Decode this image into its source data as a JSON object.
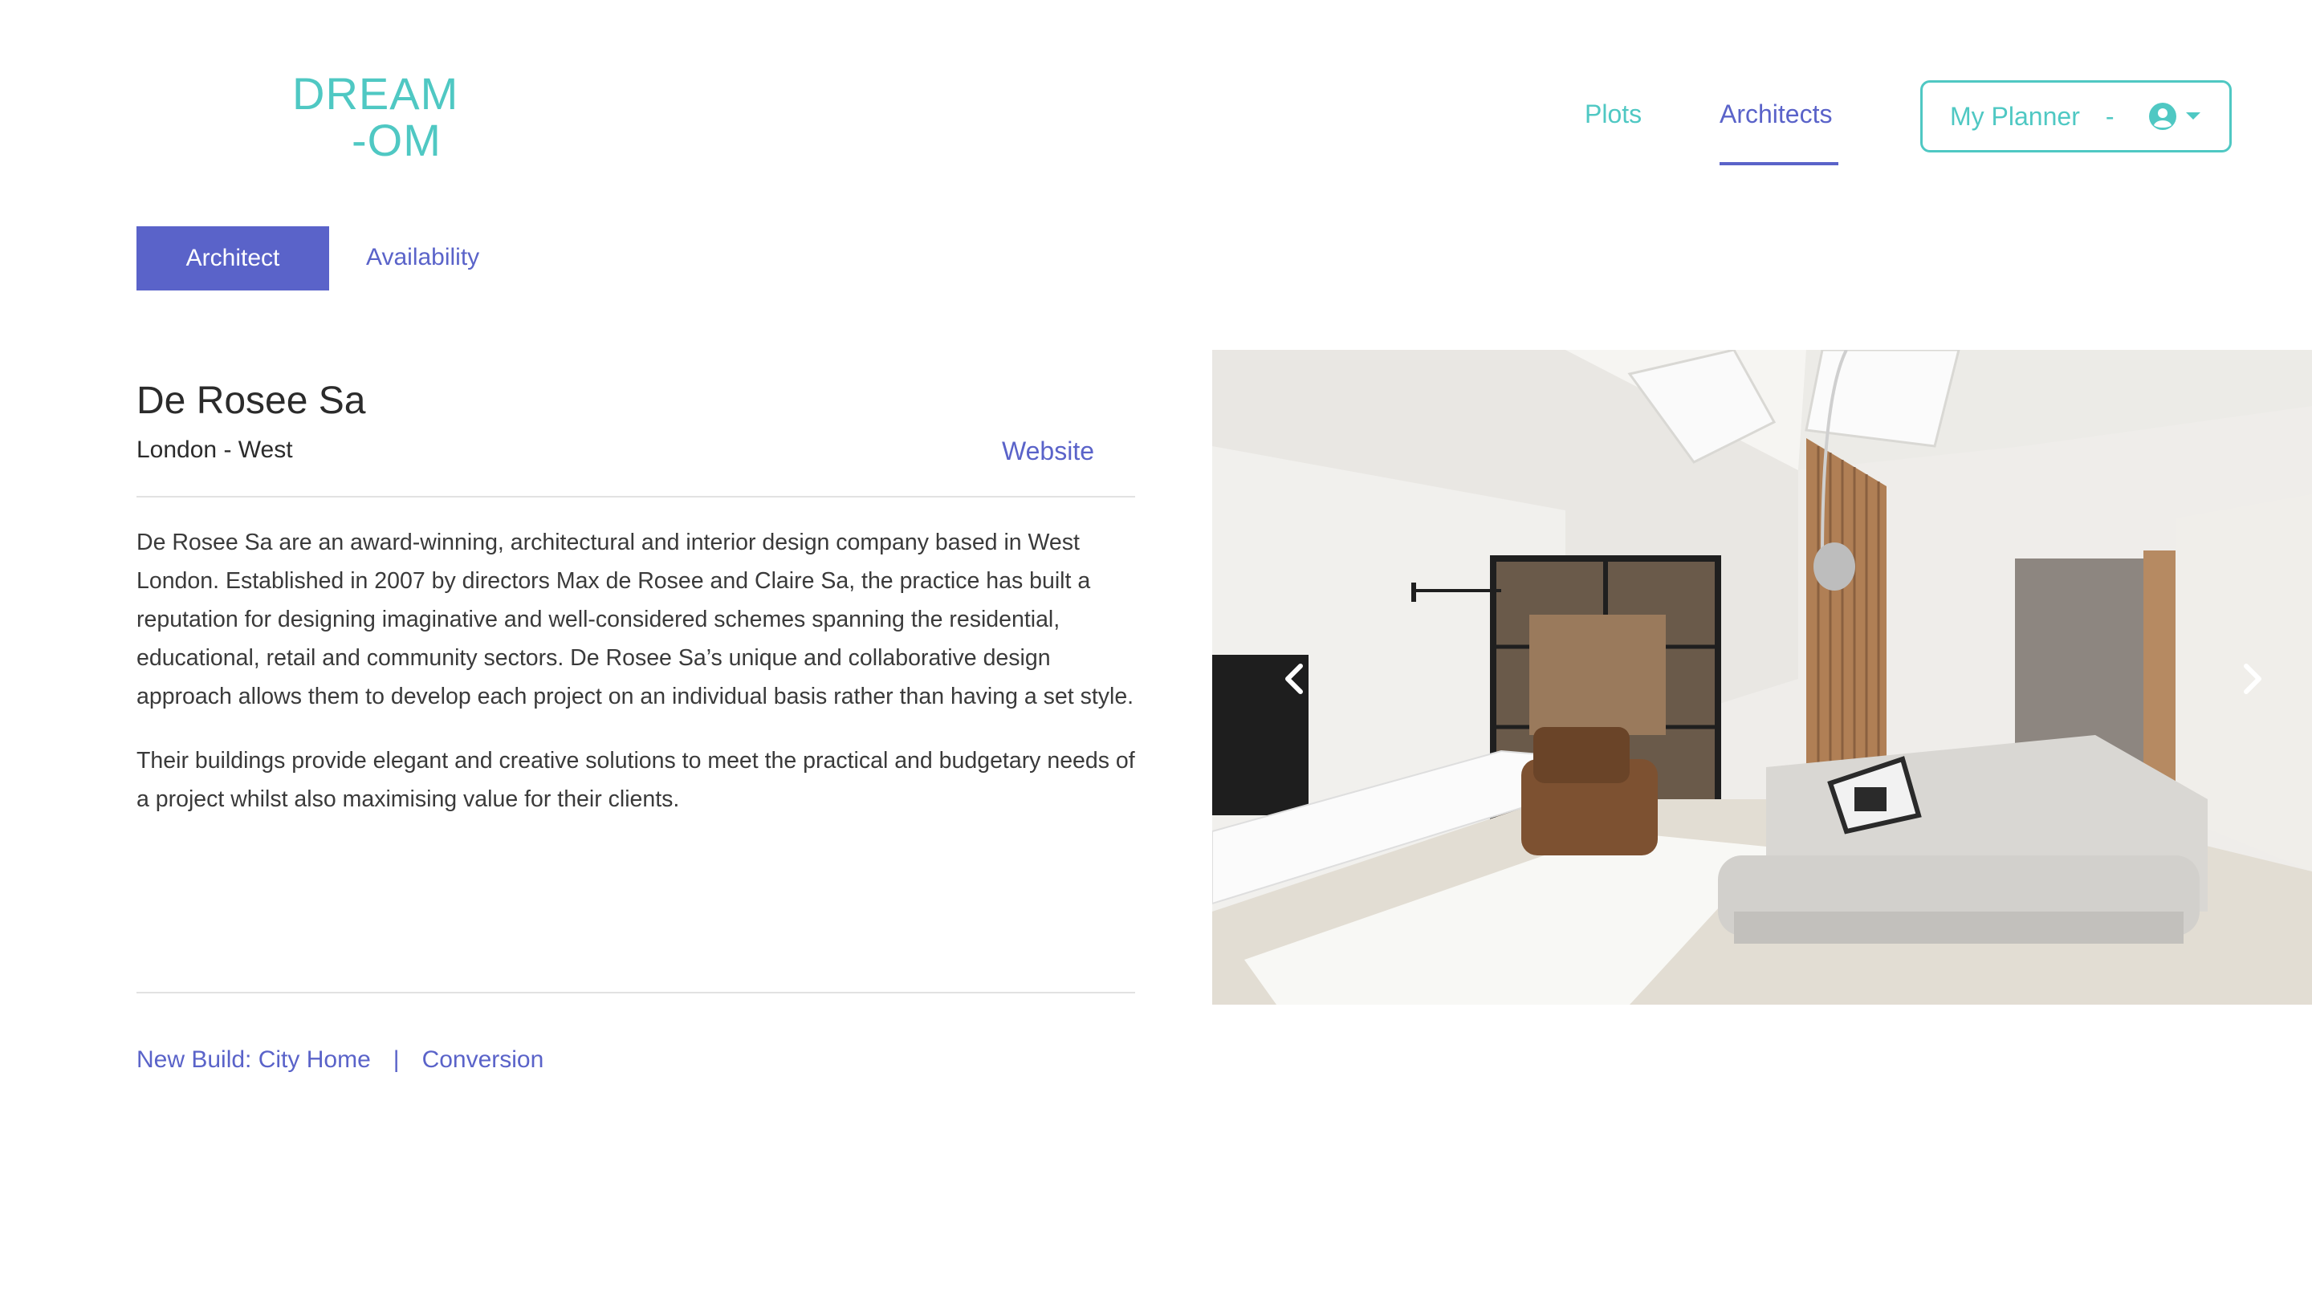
{
  "logo": {
    "line1": "DREAM",
    "line2": "-OM"
  },
  "nav": {
    "plots": "Plots",
    "architects": "Architects"
  },
  "planner": {
    "label": "My Planner",
    "dash": "-"
  },
  "tabs": {
    "architect": "Architect",
    "availability": "Availability"
  },
  "architect": {
    "name": "De Rosee Sa",
    "location": "London - West",
    "website": "Website",
    "description": [
      "De Rosee Sa are an award-winning, architectural and interior design company based in West London. Established in 2007 by directors Max de Rosee and Claire Sa, the practice has built a reputation for designing imaginative and well-considered schemes spanning the residential, educational, retail and community sectors. De Rosee Sa’s unique and collaborative design approach allows them to develop each project on an individual basis rather than having a set style.",
      "Their buildings provide elegant and creative solutions to meet the practical and budgetary needs of a project whilst also maximising value for their clients."
    ],
    "tags": [
      "New Build: City Home",
      "Conversion"
    ],
    "tag_separator": "|"
  },
  "colors": {
    "teal": "#4fc8c3",
    "indigo": "#5a63c9"
  },
  "icons": {
    "user": "user-circle-icon",
    "caret": "caret-down-icon",
    "prev": "chevron-left-icon",
    "next": "chevron-right-icon"
  }
}
